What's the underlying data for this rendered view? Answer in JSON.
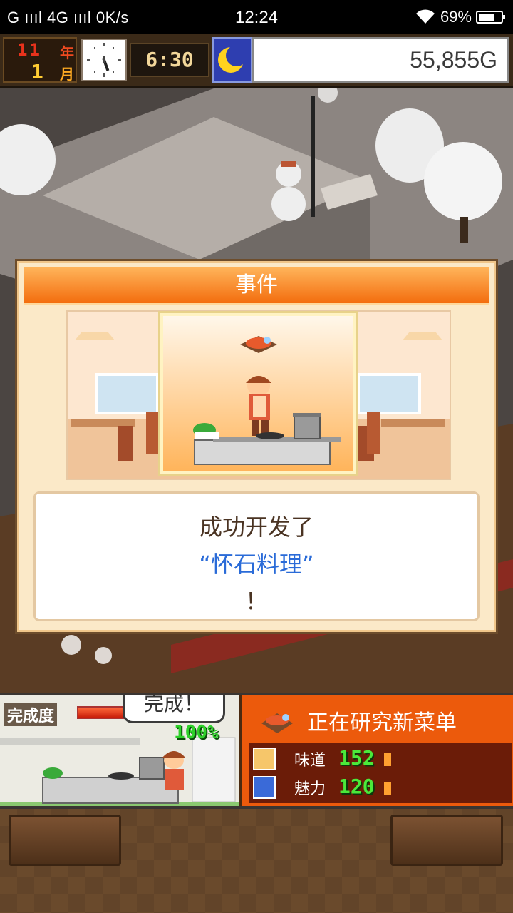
{
  "status_bar": {
    "network_left": "G ıııl 4G ıııl 0K/s",
    "time": "12:24",
    "battery_pct": "69%",
    "battery_level": 0.69
  },
  "hud": {
    "year_value": "11",
    "year_unit": "年",
    "month_value": "1",
    "month_unit": "月",
    "game_time": "6:30",
    "money": "55,855G",
    "icons": [
      "clock-icon",
      "moon-icon"
    ]
  },
  "event_dialog": {
    "title": "事件",
    "message_line1": "成功开发了",
    "message_line2": "“怀石料理”",
    "message_line3": "！"
  },
  "kitchen": {
    "progress_label": "完成度",
    "progress_fraction": 1.0,
    "speech_bubble": "完成！",
    "progress_percent": "100%"
  },
  "research": {
    "title": "正在研究新菜单",
    "stats": [
      {
        "name": "味道",
        "value": "152",
        "icon": "taste-icon",
        "bar_fraction": 0.06
      },
      {
        "name": "魅力",
        "value": "120",
        "icon": "charm-icon",
        "bar_fraction": 0.06
      }
    ]
  },
  "colors": {
    "header_orange": "#f36d0e",
    "message_blue": "#2a6bd8",
    "stat_green": "#4ce83a",
    "research_bg": "#ec5a0c"
  }
}
